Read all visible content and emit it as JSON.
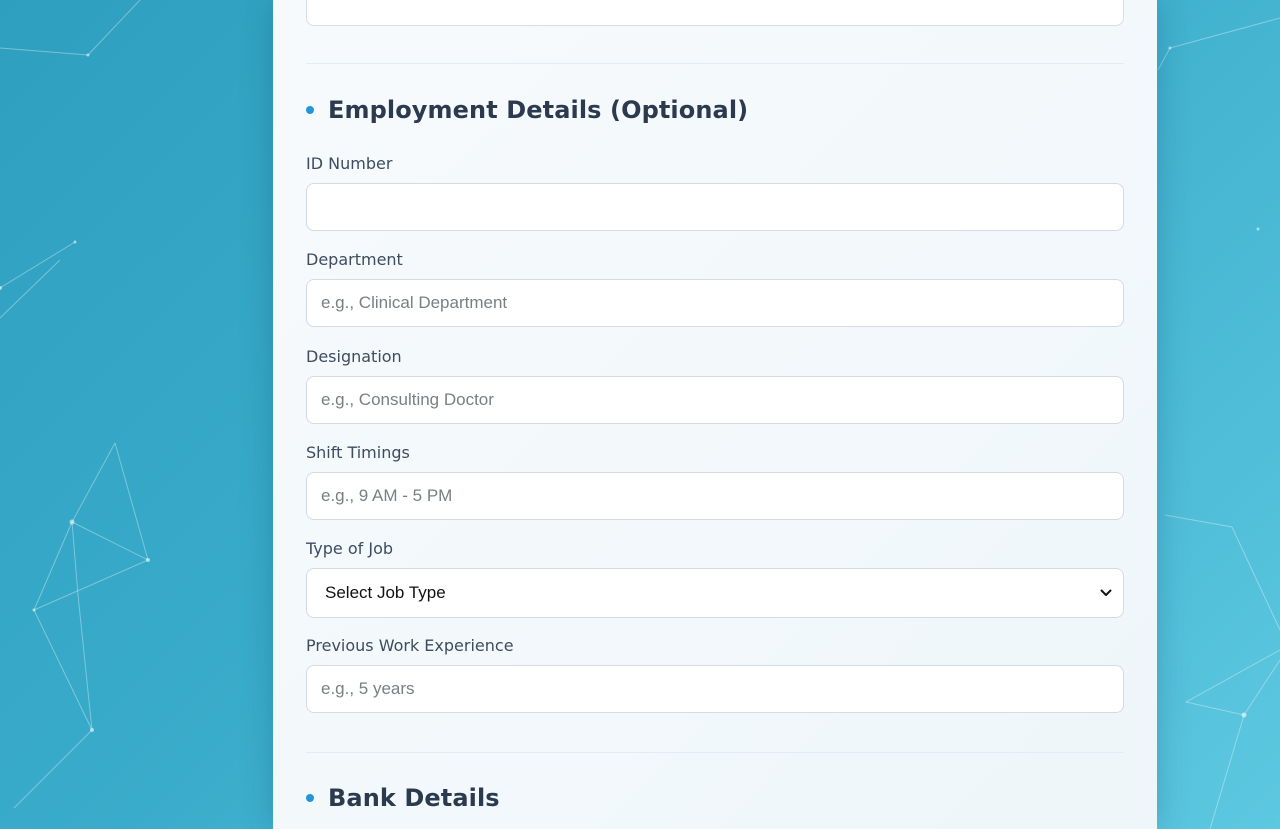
{
  "sections": {
    "employment": {
      "title": "Employment Details (Optional)"
    },
    "bank": {
      "title": "Bank Details"
    }
  },
  "fields": {
    "id_number": {
      "label": "ID Number",
      "value": "",
      "placeholder": ""
    },
    "department": {
      "label": "Department",
      "value": "",
      "placeholder": "e.g., Clinical Department"
    },
    "designation": {
      "label": "Designation",
      "value": "",
      "placeholder": "e.g., Consulting Doctor"
    },
    "shift_timings": {
      "label": "Shift Timings",
      "value": "",
      "placeholder": "e.g., 9 AM - 5 PM"
    },
    "job_type": {
      "label": "Type of Job",
      "selected": "Select Job Type",
      "icon": "chevron-down-icon"
    },
    "previous_experience": {
      "label": "Previous Work Experience",
      "value": "",
      "placeholder": "e.g., 5 years"
    }
  },
  "colors": {
    "accent": "#2196d8",
    "heading": "#2b3a4f",
    "background_start": "#2f9fbf",
    "background_end": "#5dc8e0"
  }
}
